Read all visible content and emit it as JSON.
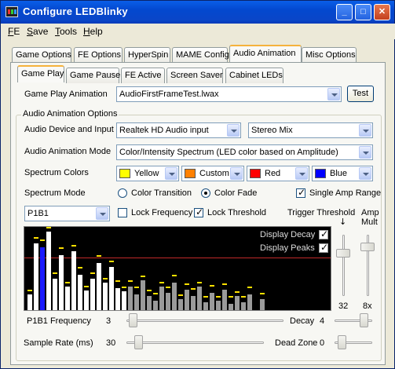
{
  "window": {
    "title": "Configure LEDBlinky"
  },
  "menu": [
    {
      "label": "FE",
      "underline": "F",
      "rest": "E"
    },
    {
      "label": "Save",
      "underline": "S",
      "rest": "ave"
    },
    {
      "label": "Tools",
      "underline": "T",
      "rest": "ools"
    },
    {
      "label": "Help",
      "underline": "H",
      "rest": "elp"
    }
  ],
  "main_tabs": [
    "Game Options",
    "FE Options",
    "HyperSpin",
    "MAME Config",
    "Audio Animation",
    "Misc Options"
  ],
  "main_tab_active": "Audio Animation",
  "sub_tabs": [
    "Game Play",
    "Game Pause",
    "FE Active",
    "Screen Saver",
    "Cabinet LEDs"
  ],
  "sub_tab_active": "Game Play",
  "game_play_animation": {
    "label": "Game Play Animation",
    "value": "AudioFirstFrameTest.lwax",
    "test_button": "Test"
  },
  "audio_options": {
    "group_title": "Audio Animation Options",
    "device_label": "Audio Device and Input",
    "device_value": "Realtek HD Audio input",
    "input_value": "Stereo Mix",
    "mode_label": "Audio Animation Mode",
    "mode_value": "Color/Intensity Spectrum (LED color based on Amplitude)",
    "spectrum_colors_label": "Spectrum Colors",
    "spectrum_colors": [
      {
        "name": "Yellow",
        "color": "#ffff00"
      },
      {
        "name": "Custom",
        "color": "#ff8000"
      },
      {
        "name": "Red",
        "color": "#ff0000"
      },
      {
        "name": "Blue",
        "color": "#0000ff"
      }
    ],
    "spectrum_mode_label": "Spectrum Mode",
    "color_transition": "Color Transition",
    "color_fade": "Color Fade",
    "spectrum_mode_selected": "Color Fade",
    "single_amp_range": "Single Amp Range",
    "single_amp_range_checked": true,
    "led_value": "P1B1",
    "lock_frequency": "Lock Frequency",
    "lock_frequency_checked": false,
    "lock_threshold": "Lock Threshold",
    "lock_threshold_checked": true,
    "trigger_threshold_label": "Trigger Threshold",
    "trigger_threshold_value": "32",
    "amp_mult_label_1": "Amp",
    "amp_mult_label_2": "Mult",
    "amp_mult_value": "8x",
    "display_decay": "Display Decay",
    "display_peaks": "Display Peaks",
    "frequency_label": "P1B1 Frequency",
    "frequency_value": "3",
    "decay_label": "Decay",
    "decay_value": "4",
    "sample_rate_label": "Sample Rate (ms)",
    "sample_rate_value": "30",
    "dead_zone_label": "Dead Zone",
    "dead_zone_value": "0"
  },
  "colors": {
    "white_bar": "#ffffff",
    "selected_bar": "#1a1aff",
    "gray_bar": "#9a9a9a",
    "peak": "#ffe000",
    "threshold_line": "#c02a2a"
  }
}
